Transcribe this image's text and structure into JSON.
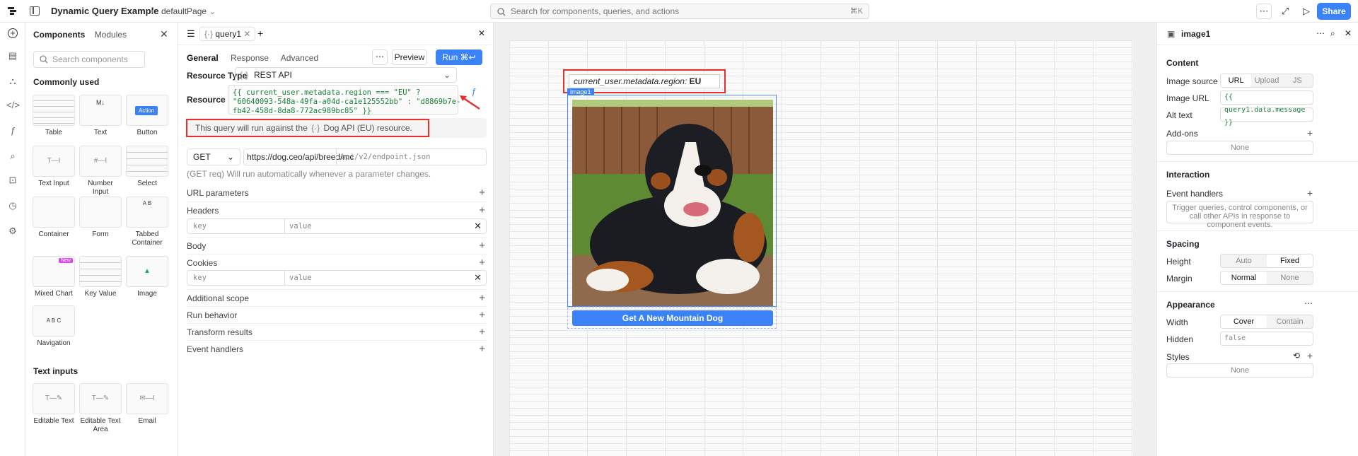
{
  "topbar": {
    "app_title": "Dynamic Query Example",
    "separator": "/",
    "page_name": "defaultPage",
    "search_placeholder": "Search for components, queries, and actions",
    "search_shortcut": "⌘K",
    "share_label": "Share"
  },
  "components_panel": {
    "tab_components": "Components",
    "tab_modules": "Modules",
    "search_placeholder": "Search components",
    "commonly_used_heading": "Commonly used",
    "text_inputs_heading": "Text inputs",
    "commonly_used": [
      {
        "label": "Table"
      },
      {
        "label": "Text"
      },
      {
        "label": "Button",
        "box_text": "Action"
      },
      {
        "label": "Text Input"
      },
      {
        "label": "Number Input"
      },
      {
        "label": "Select"
      },
      {
        "label": "Container"
      },
      {
        "label": "Form"
      },
      {
        "label": "Tabbed Container"
      },
      {
        "label": "Mixed Chart",
        "badge": "New"
      },
      {
        "label": "Key Value"
      },
      {
        "label": "Image"
      },
      {
        "label": "Navigation"
      }
    ],
    "text_inputs": [
      {
        "label": "Editable Text"
      },
      {
        "label": "Editable Text Area"
      },
      {
        "label": "Email"
      }
    ]
  },
  "query_panel": {
    "tab_name": "query1",
    "tabs": [
      "General",
      "Response",
      "Advanced"
    ],
    "preview_label": "Preview",
    "run_label": "Run ⌘↩",
    "resource_type_label": "Resource Type",
    "resource_type_value": "REST API",
    "resource_id_label": "Resource ID",
    "resource_id_code_line1": "{{ current_user.metadata.region === \"EU\" ?",
    "resource_id_code_line2": "\"60640093-548a-49fa-a04d-ca1e125552bb\" : \"d8869b7e-",
    "resource_id_code_line3": "fb42-458d-8da8-772ac989bc85\" }}",
    "note_prefix": "This query will run against the",
    "note_resource": "Dog API (EU)",
    "note_suffix": "resource.",
    "method": "GET",
    "url_value": "https://dog.ceo/api/breed/mc",
    "url_placeholder": "api/v2/endpoint.json",
    "hint": "(GET req) Will run automatically whenever a parameter changes.",
    "sections": {
      "url_parameters": "URL parameters",
      "headers": "Headers",
      "body": "Body",
      "cookies": "Cookies",
      "additional_scope": "Additional scope",
      "run_behavior": "Run behavior",
      "transform_results": "Transform results",
      "event_handlers": "Event handlers"
    },
    "kv_key_placeholder": "key",
    "kv_value_placeholder": "value"
  },
  "canvas": {
    "text_label": "current_user.metadata.region:",
    "text_value": "EU",
    "image_badge": "image1",
    "button_label": "Get A New Mountain Dog"
  },
  "inspector": {
    "component_name": "image1",
    "content_heading": "Content",
    "image_source_label": "Image source",
    "image_source_options": [
      "URL",
      "Upload",
      "JS"
    ],
    "image_url_label": "Image URL",
    "image_url_value": "{{ query1.data.message }}",
    "alt_text_label": "Alt text",
    "addons_label": "Add-ons",
    "addons_value": "None",
    "interaction_heading": "Interaction",
    "event_handlers_label": "Event handlers",
    "event_handlers_hint": "Trigger queries, control components, or call other APIs in response to component events.",
    "spacing_heading": "Spacing",
    "height_label": "Height",
    "height_options": [
      "Auto",
      "Fixed"
    ],
    "margin_label": "Margin",
    "margin_options": [
      "Normal",
      "None"
    ],
    "appearance_heading": "Appearance",
    "width_label": "Width",
    "width_options": [
      "Cover",
      "Contain"
    ],
    "hidden_label": "Hidden",
    "hidden_value": "false",
    "styles_label": "Styles",
    "styles_value": "None"
  },
  "colors": {
    "accent": "#3b82f6",
    "highlight_red": "#e5302d",
    "code_green": "#188038"
  }
}
